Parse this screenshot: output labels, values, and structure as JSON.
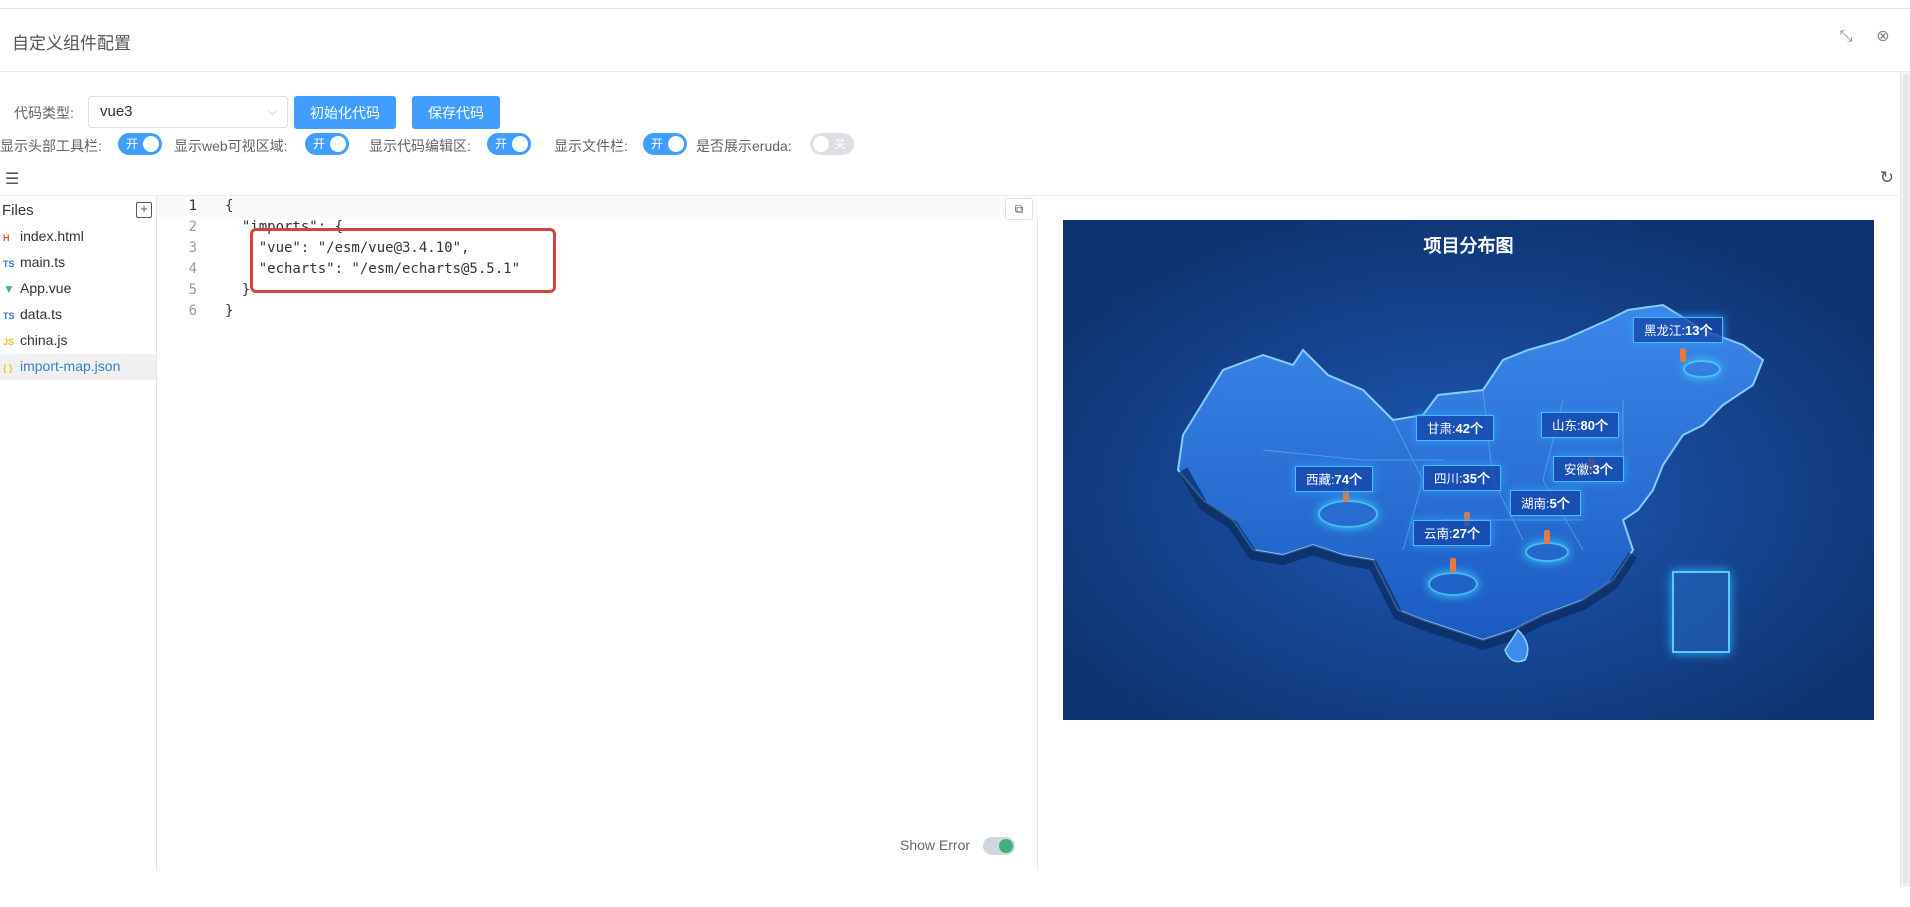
{
  "window": {
    "title": "自定义组件配置"
  },
  "toolbar": {
    "code_type_label": "代码类型:",
    "code_type_value": "vue3",
    "init_button": "初始化代码",
    "save_button": "保存代码"
  },
  "toggles": [
    {
      "label": "显示头部工具栏:",
      "state": "开",
      "on": true
    },
    {
      "label": "显示web可视区域:",
      "state": "开",
      "on": true
    },
    {
      "label": "显示代码编辑区:",
      "state": "开",
      "on": true
    },
    {
      "label": "显示文件栏:",
      "state": "开",
      "on": true
    },
    {
      "label": "是否展示eruda:",
      "state": "关",
      "on": false
    }
  ],
  "files": {
    "title": "Files",
    "items": [
      {
        "name": "index.html",
        "icon": "html-icon",
        "active": false
      },
      {
        "name": "main.ts",
        "icon": "ts-icon",
        "active": false
      },
      {
        "name": "App.vue",
        "icon": "vue-icon",
        "active": false
      },
      {
        "name": "data.ts",
        "icon": "ts-icon",
        "active": false
      },
      {
        "name": "china.js",
        "icon": "js-icon",
        "active": false
      },
      {
        "name": "import-map.json",
        "icon": "json-icon",
        "active": true
      }
    ]
  },
  "editor": {
    "lines": [
      {
        "n": "1",
        "text": "{"
      },
      {
        "n": "2",
        "text": "  \"imports\": {"
      },
      {
        "n": "3",
        "text": "    \"vue\": \"/esm/vue@3.4.10\","
      },
      {
        "n": "4",
        "text": "    \"echarts\": \"/esm/echarts@5.5.1\""
      },
      {
        "n": "5",
        "text": "  }"
      },
      {
        "n": "6",
        "text": "}"
      }
    ],
    "show_error_label": "Show Error"
  },
  "preview": {
    "title": "项目分布图",
    "labels": [
      {
        "province": "黑龙江",
        "count": "13个"
      },
      {
        "province": "甘肃",
        "count": "42个"
      },
      {
        "province": "山东",
        "count": "80个"
      },
      {
        "province": "西藏",
        "count": "74个"
      },
      {
        "province": "四川",
        "count": "35个"
      },
      {
        "province": "安徽",
        "count": "3个"
      },
      {
        "province": "湖南",
        "count": "5个"
      },
      {
        "province": "云南",
        "count": "27个"
      }
    ]
  },
  "colors": {
    "accent": "#409eff",
    "highlight": "#d9423a",
    "map_bg": "#0f3371"
  }
}
